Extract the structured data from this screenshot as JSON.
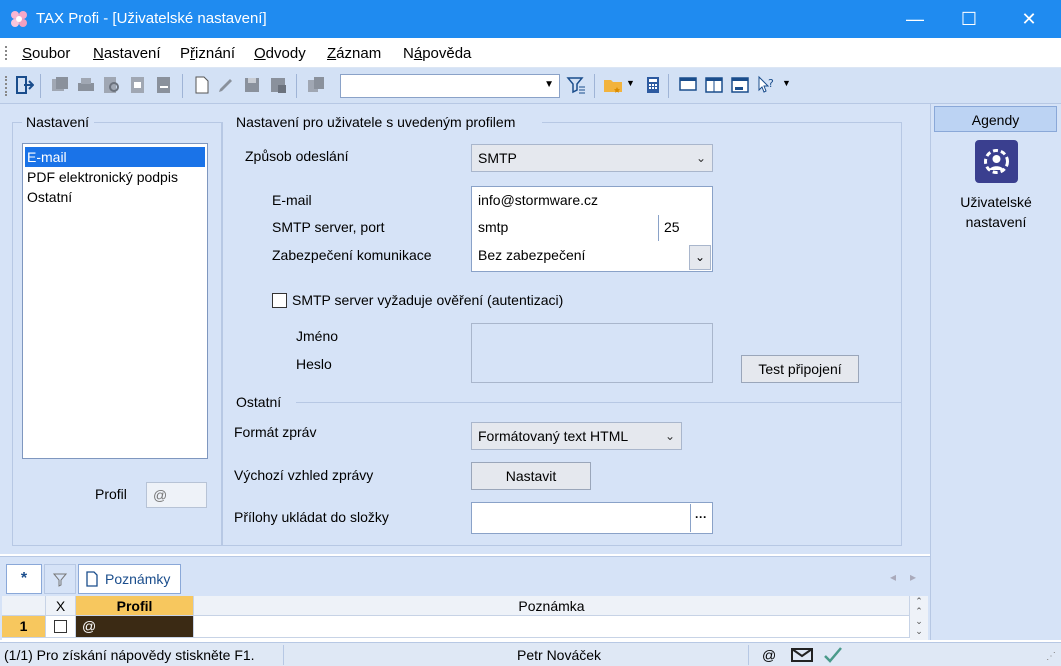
{
  "window": {
    "title": "TAX Profi - [Uživatelské nastavení]",
    "minimize": "—",
    "maximize": "☐",
    "close": "✕"
  },
  "menu": {
    "items": [
      {
        "label": "Soubor",
        "ul": "S",
        "rest": "oubor"
      },
      {
        "label": "Nastavení",
        "ul": "N",
        "rest": "astavení"
      },
      {
        "label": "Přiznání",
        "pre": "P",
        "ul": "ř",
        "rest": "iznání"
      },
      {
        "label": "Odvody",
        "ul": "O",
        "rest": "dvody"
      },
      {
        "label": "Záznam",
        "ul": "Z",
        "rest": "áznam"
      },
      {
        "label": "Nápověda",
        "pre": "N",
        "ul": "á",
        "rest": "pověda"
      }
    ]
  },
  "toolbar": {
    "combo_value": ""
  },
  "left_panel": {
    "legend": "Nastavení",
    "items": [
      "E-mail",
      "PDF elektronický podpis",
      "Ostatní"
    ],
    "selected": "E-mail",
    "profile_label": "Profil",
    "profile_value": "@"
  },
  "profile_settings": {
    "legend": "Nastavení pro uživatele s uvedeným profilem",
    "send_method_label": "Způsob odeslání",
    "send_method_value": "SMTP",
    "email_label": "E-mail",
    "email_value": "info@stormware.cz",
    "smtp_label": "SMTP server, port",
    "smtp_server": "smtp",
    "smtp_port": "25",
    "security_label": "Zabezpečení komunikace",
    "security_value": "Bez zabezpečení",
    "auth_checkbox_label": "SMTP server vyžaduje ověření (autentizaci)",
    "auth_checked": false,
    "name_label": "Jméno",
    "password_label": "Heslo",
    "test_button": "Test připojení"
  },
  "other": {
    "legend": "Ostatní",
    "format_label": "Formát zpráv",
    "format_value": "Formátovaný text HTML",
    "default_look_label": "Výchozí vzhled zprávy",
    "set_button": "Nastavit",
    "attachments_label": "Přílohy ukládat do složky",
    "attachments_value": "",
    "browse_button": "···"
  },
  "agendy": {
    "header": "Agendy",
    "item_label_line1": "Uživatelské",
    "item_label_line2": "nastavení"
  },
  "notes": {
    "tab_star": "*",
    "tab_notes": "Poznámky",
    "columns": [
      "X",
      "Profil",
      "Poznámka"
    ],
    "rows": [
      {
        "num": "1",
        "x": "",
        "profil": "@",
        "poznamka": ""
      }
    ]
  },
  "status": {
    "left": "(1/1)  Pro získání nápovědy stiskněte F1.",
    "user": "Petr Nováček",
    "at": "@"
  },
  "colors": {
    "accent": "#1f8bf0",
    "panel": "#d6e3f7",
    "selected": "#1a73e8"
  }
}
